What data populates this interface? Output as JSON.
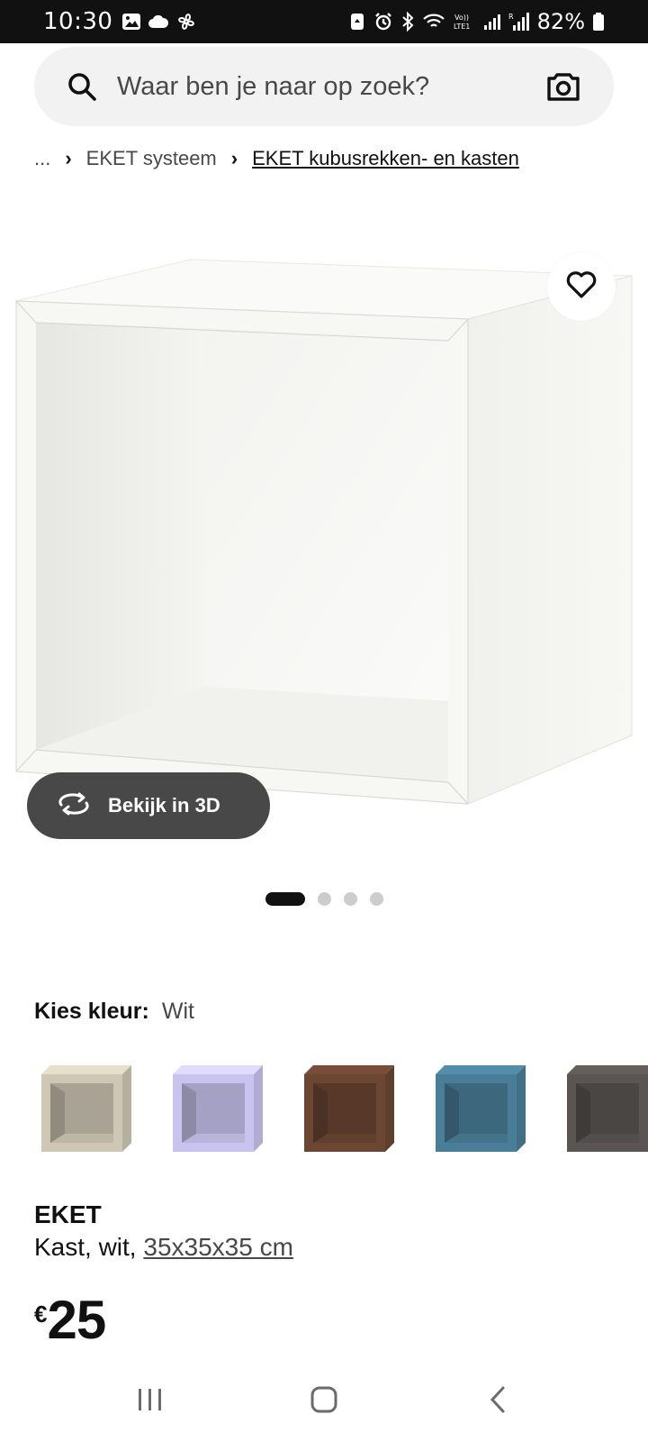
{
  "status_bar": {
    "time": "10:30",
    "battery": "82%",
    "icons_left": [
      "gallery-icon",
      "cloud-icon",
      "fan-icon"
    ],
    "icons_right": [
      "recycle-icon",
      "alarm-icon",
      "bluetooth-icon",
      "wifi-icon",
      "lte-icon",
      "signal-icon",
      "signal-roaming-icon",
      "battery-icon"
    ]
  },
  "search": {
    "placeholder": "Waar ben je naar op zoek?"
  },
  "breadcrumb": {
    "ellipsis": "...",
    "separator": "›",
    "items": [
      "EKET systeem",
      "EKET kubusrekken- en kasten"
    ]
  },
  "gallery": {
    "view_3d_label": "Bekijk in 3D",
    "page_count": 4,
    "active_page": 1
  },
  "colour": {
    "label": "Kies kleur:",
    "value": "Wit",
    "swatches": [
      {
        "name": "beige",
        "color": "#cdc7b4"
      },
      {
        "name": "lilac",
        "color": "#c9c4ef"
      },
      {
        "name": "walnut",
        "color": "#6b4632"
      },
      {
        "name": "blue",
        "color": "#4a7e98"
      },
      {
        "name": "dark-grey",
        "color": "#5a5552"
      }
    ]
  },
  "product": {
    "name": "EKET",
    "description_prefix": "Kast, wit, ",
    "dimensions": "35x35x35 cm",
    "currency": "€",
    "price": "25"
  },
  "colors": {
    "accent_dark": "#111111",
    "button_grey": "#484848",
    "search_bg": "#f2f2f2"
  }
}
